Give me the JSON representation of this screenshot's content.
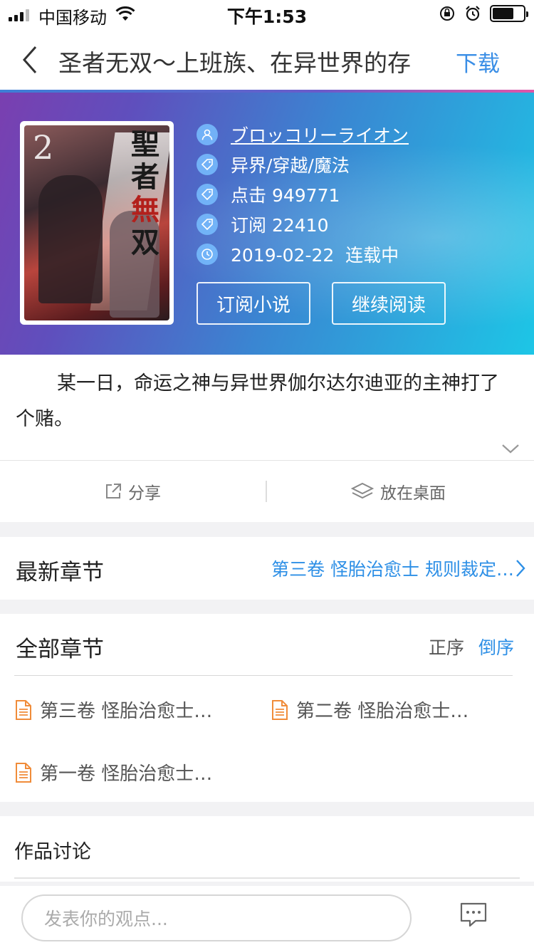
{
  "status_bar": {
    "carrier": "中国移动",
    "time": "下午1:53"
  },
  "nav": {
    "title": "圣者无双～上班族、在异世界的存",
    "download": "下载"
  },
  "book": {
    "cover_title_chars": [
      "聖",
      "者",
      "無",
      "双"
    ],
    "cover_volume": "2",
    "author": "ブロッコリーライオン",
    "tags": "异界/穿越/魔法",
    "clicks": "点击 949771",
    "subscriptions": "订阅 22410",
    "update": "2019-02-22  连载中",
    "subscribe_button": "订阅小说",
    "continue_button": "继续阅读"
  },
  "description": "某一日，命运之神与异世界伽尔达尔迪亚的主神打了个赌。",
  "actions": {
    "share": "分享",
    "desktop": "放在桌面"
  },
  "latest": {
    "title": "最新章节",
    "chapter": "第三卷 怪胎治愈士 规则裁定…"
  },
  "all_chapters": {
    "title": "全部章节",
    "sort_asc": "正序",
    "sort_desc": "倒序",
    "items": [
      {
        "label": "第三卷 怪胎治愈士…"
      },
      {
        "label": "第二卷 怪胎治愈士…"
      },
      {
        "label": "第一卷 怪胎治愈士…"
      }
    ]
  },
  "discussion": {
    "title": "作品讨论"
  },
  "comment": {
    "placeholder": "发表你的观点..."
  },
  "colors": {
    "accent": "#2d8fe6",
    "doc_icon": "#f08c3a"
  },
  "icons": [
    "back-icon",
    "user-icon",
    "tag-icon",
    "clock-icon",
    "chevron-down-icon",
    "share-icon",
    "layers-icon",
    "chevron-right-icon",
    "document-icon",
    "comment-icon"
  ]
}
